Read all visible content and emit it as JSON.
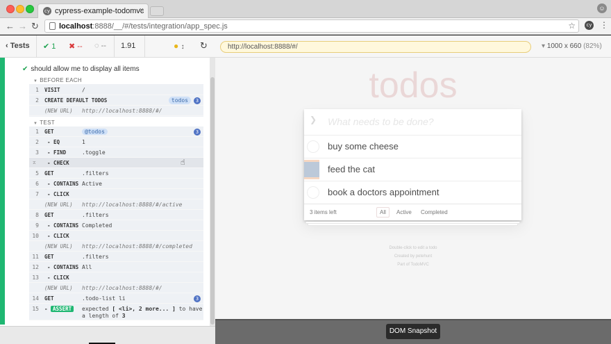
{
  "browser": {
    "tab_title": "cypress-example-todomvc",
    "favicon": "cy",
    "url_host": "localhost",
    "url_rest": ":8888/__/#/tests/integration/app_spec.js",
    "extension_label": "cy"
  },
  "runner": {
    "back_label": "Tests",
    "passed": "1",
    "failed": "--",
    "pending": "--",
    "duration": "1.91",
    "app_url": "http://localhost:8888/#/",
    "viewport": "1000 x 660",
    "scale": "(82%)"
  },
  "log": {
    "test_title": "should allow me to display all items",
    "before_each_label": "BEFORE EACH",
    "test_label": "TEST",
    "before_each": [
      {
        "num": "1",
        "name": "VISIT",
        "msg": "/"
      },
      {
        "num": "2",
        "name": "CREATE DEFAULT TODOS",
        "msg": "",
        "alias": "todos",
        "badge": "3"
      },
      {
        "num": "",
        "name": "(NEW URL)",
        "msg": "http://localhost:8888/#/"
      }
    ],
    "test": [
      {
        "num": "1",
        "name": "GET",
        "msg": "@todos",
        "badge": "3"
      },
      {
        "num": "2",
        "name": "- EQ",
        "msg": "1"
      },
      {
        "num": "3",
        "name": "- FIND",
        "msg": ".toggle"
      },
      {
        "num": "",
        "name": "- CHECK",
        "msg": ""
      },
      {
        "num": "5",
        "name": "GET",
        "msg": ".filters"
      },
      {
        "num": "6",
        "name": "- CONTAINS",
        "msg": "Active"
      },
      {
        "num": "7",
        "name": "- CLICK",
        "msg": ""
      },
      {
        "num": "",
        "name": "(NEW URL)",
        "msg": "http://localhost:8888/#/active"
      },
      {
        "num": "8",
        "name": "GET",
        "msg": ".filters"
      },
      {
        "num": "9",
        "name": "- CONTAINS",
        "msg": "Completed"
      },
      {
        "num": "10",
        "name": "- CLICK",
        "msg": ""
      },
      {
        "num": "",
        "name": "(NEW URL)",
        "msg": "http://localhost:8888/#/completed"
      },
      {
        "num": "11",
        "name": "GET",
        "msg": ".filters"
      },
      {
        "num": "12",
        "name": "- CONTAINS",
        "msg": "All"
      },
      {
        "num": "13",
        "name": "- CLICK",
        "msg": ""
      },
      {
        "num": "",
        "name": "(NEW URL)",
        "msg": "http://localhost:8888/#/"
      },
      {
        "num": "14",
        "name": "GET",
        "msg": ".todo-list li",
        "badge": "3"
      }
    ],
    "assert": {
      "num": "15",
      "tag": "ASSERT",
      "line1_a": "expected ",
      "line1_b": "[ <li>, 2 more... ]",
      "line1_c": " to have",
      "line2_a": "a length of ",
      "line2_b": "3"
    }
  },
  "app": {
    "title": "todos",
    "placeholder": "What needs to be done?",
    "todos": [
      "buy some cheese",
      "feed the cat",
      "book a doctors appointment"
    ],
    "items_left": "3 items left",
    "filters": [
      "All",
      "Active",
      "Completed"
    ],
    "info": [
      "Double-click to edit a todo",
      "Created by petehunt",
      "Part of TodoMVC"
    ]
  },
  "snapshot_label": "DOM Snapshot",
  "colors": {
    "pass": "#1fa351",
    "fail": "#d9383a",
    "accent": "#1fb772",
    "badge": "#4f72c4"
  }
}
